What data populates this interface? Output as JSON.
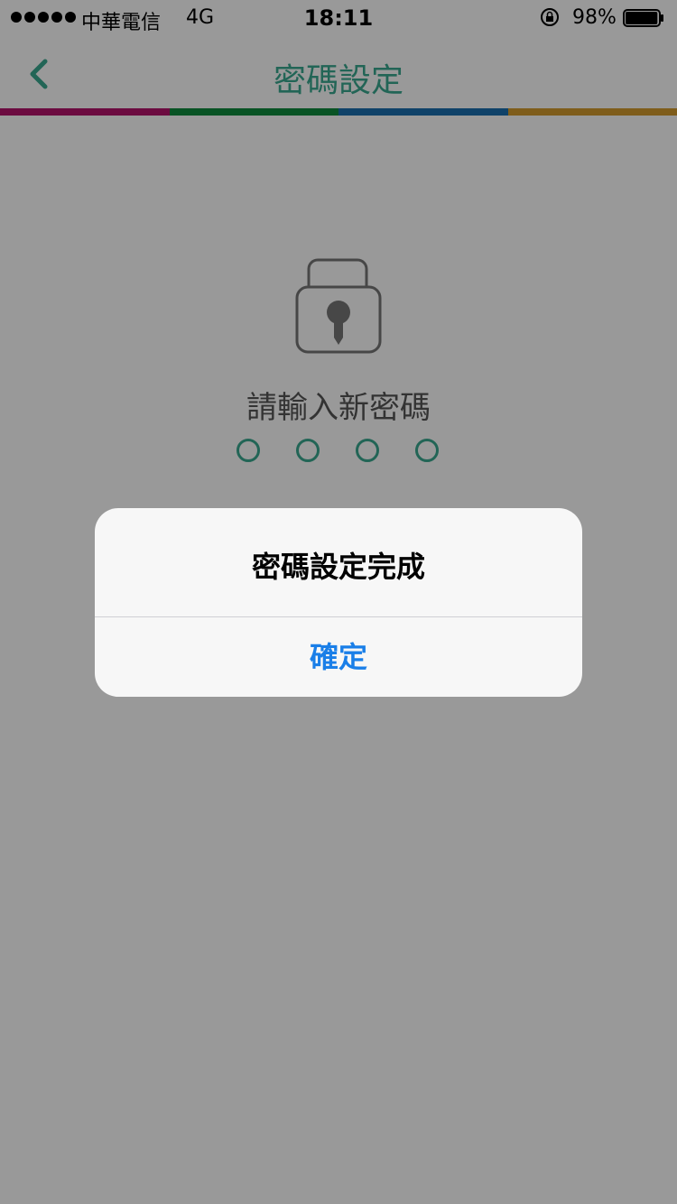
{
  "status_bar": {
    "carrier": "中華電信",
    "network": "4G",
    "time": "18:11",
    "battery": "98%",
    "battery_level": 0.98
  },
  "nav": {
    "title": "密碼設定",
    "back_icon": "chevron-left-icon",
    "strip_colors": [
      "#b5136b",
      "#0e8a3d",
      "#1a6fb0",
      "#d49b2e"
    ]
  },
  "content": {
    "icon": "padlock-icon",
    "prompt": "請輸入新密碼",
    "dot_count": 4
  },
  "alert": {
    "title": "密碼設定完成",
    "confirm": "確定"
  },
  "colors": {
    "accent": "#3aa88f",
    "link_blue": "#1a7fe8"
  }
}
